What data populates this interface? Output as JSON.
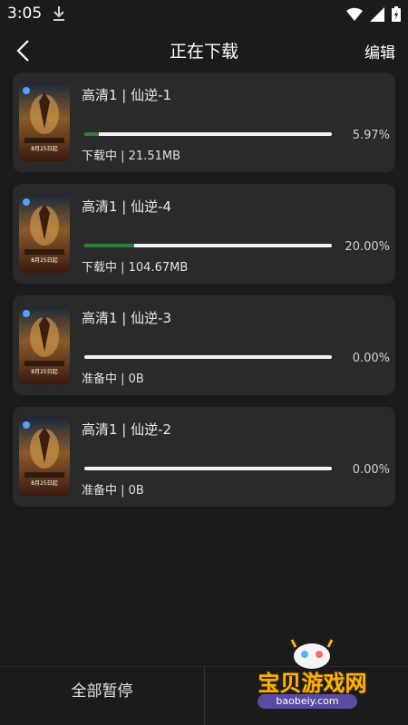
{
  "status_bar": {
    "time": "3:05",
    "icons": [
      "download-icon",
      "wifi-icon",
      "signal-icon",
      "battery-icon"
    ]
  },
  "app_bar": {
    "title": "正在下载",
    "edit_label": "编辑"
  },
  "downloads": [
    {
      "name": "高清1 | 仙逆-1",
      "progress_percent": "5.97%",
      "progress": 0.0597,
      "status": "下载中 | 21.51MB"
    },
    {
      "name": "高清1 | 仙逆-4",
      "progress_percent": "20.00%",
      "progress": 0.2,
      "status": "下载中 | 104.67MB"
    },
    {
      "name": "高清1 | 仙逆-3",
      "progress_percent": "0.00%",
      "progress": 0.0,
      "status": "准备中 | 0B"
    },
    {
      "name": "高清1 | 仙逆-2",
      "progress_percent": "0.00%",
      "progress": 0.0,
      "status": "准备中 | 0B"
    }
  ],
  "thumbnail": {
    "date_text": "8月25日起"
  },
  "bottom_bar": {
    "pause_all_label": "全部暂停"
  },
  "watermark": {
    "text": "宝贝游戏网",
    "url": "baobeiy.com"
  },
  "colors": {
    "background": "#1b1b1b",
    "card": "#2a2a2a",
    "progress_fill": "#2e7d3a",
    "progress_track": "#f2f2f2"
  }
}
